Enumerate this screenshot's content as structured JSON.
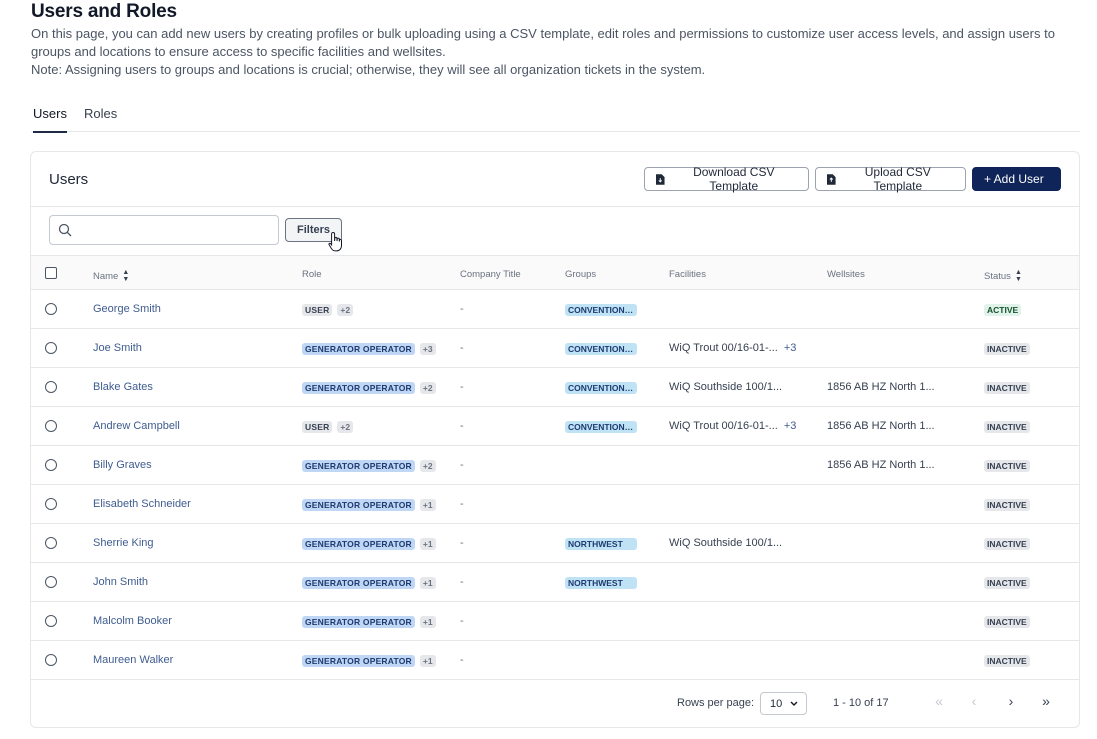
{
  "page": {
    "title": "Users and Roles",
    "description": "On this page, you can add new users by creating profiles or bulk uploading using a CSV template, edit roles and permissions to customize user access levels, and assign users to groups and locations to ensure access to specific facilities and wellsites.",
    "note": "Note: Assigning users to groups and locations is crucial; otherwise, they will see all organization tickets in the system."
  },
  "tabs": [
    {
      "label": "Users",
      "active": true
    },
    {
      "label": "Roles",
      "active": false
    }
  ],
  "card": {
    "title": "Users",
    "download_label": "Download CSV Template",
    "upload_label": "Upload CSV Template",
    "add_label": "+  Add User"
  },
  "search": {
    "placeholder": ""
  },
  "filters_label": "Filters",
  "columns": [
    "Name",
    "Role",
    "Company Title",
    "Groups",
    "Facilities",
    "Wellsites",
    "Status"
  ],
  "rows": [
    {
      "name": "George Smith",
      "role": "USER",
      "role_more": "+2",
      "company": "-",
      "group": "CONVENTIONAL",
      "facility": "",
      "facility_more": "",
      "wellsite": "",
      "status": "ACTIVE"
    },
    {
      "name": "Joe Smith",
      "role": "GENERATOR OPERATOR",
      "role_more": "+3",
      "company": "-",
      "group": "CONVENTIONAL",
      "facility": "WiQ Trout 00/16-01-...",
      "facility_more": "+3",
      "wellsite": "",
      "status": "INACTIVE"
    },
    {
      "name": "Blake Gates",
      "role": "GENERATOR OPERATOR",
      "role_more": "+2",
      "company": "-",
      "group": "CONVENTIONAL",
      "facility": "WiQ Southside 100/1...",
      "facility_more": "",
      "wellsite": "1856 AB HZ North 1...",
      "status": "INACTIVE"
    },
    {
      "name": "Andrew Campbell",
      "role": "USER",
      "role_more": "+2",
      "company": "-",
      "group": "CONVENTIONAL",
      "facility": "WiQ Trout 00/16-01-...",
      "facility_more": "+3",
      "wellsite": "1856 AB HZ North 1...",
      "status": "INACTIVE"
    },
    {
      "name": "Billy Graves",
      "role": "GENERATOR OPERATOR",
      "role_more": "+2",
      "company": "-",
      "group": "",
      "facility": "",
      "facility_more": "",
      "wellsite": "1856 AB HZ North 1...",
      "status": "INACTIVE"
    },
    {
      "name": "Elisabeth Schneider",
      "role": "GENERATOR OPERATOR",
      "role_more": "+1",
      "company": "-",
      "group": "",
      "facility": "",
      "facility_more": "",
      "wellsite": "",
      "status": "INACTIVE"
    },
    {
      "name": "Sherrie King",
      "role": "GENERATOR OPERATOR",
      "role_more": "+1",
      "company": "-",
      "group": "NORTHWEST",
      "facility": "WiQ Southside 100/1...",
      "facility_more": "",
      "wellsite": "",
      "status": "INACTIVE"
    },
    {
      "name": "John Smith",
      "role": "GENERATOR OPERATOR",
      "role_more": "+1",
      "company": "-",
      "group": "NORTHWEST",
      "facility": "",
      "facility_more": "",
      "wellsite": "",
      "status": "INACTIVE"
    },
    {
      "name": "Malcolm Booker",
      "role": "GENERATOR OPERATOR",
      "role_more": "+1",
      "company": "-",
      "group": "",
      "facility": "",
      "facility_more": "",
      "wellsite": "",
      "status": "INACTIVE"
    },
    {
      "name": "Maureen Walker",
      "role": "GENERATOR OPERATOR",
      "role_more": "+1",
      "company": "-",
      "group": "",
      "facility": "",
      "facility_more": "",
      "wellsite": "",
      "status": "INACTIVE"
    }
  ],
  "pagination": {
    "rows_per_page_label": "Rows per page:",
    "rows_per_page": "10",
    "range": "1 - 10 of 17"
  },
  "icons": {
    "search": "search-icon",
    "download": "file-download-icon",
    "upload": "file-upload-icon",
    "sort": "sort-icon",
    "cursor": "hand-pointer-icon"
  },
  "colors": {
    "primary": "#0f2458",
    "link": "#3f5c8f"
  }
}
